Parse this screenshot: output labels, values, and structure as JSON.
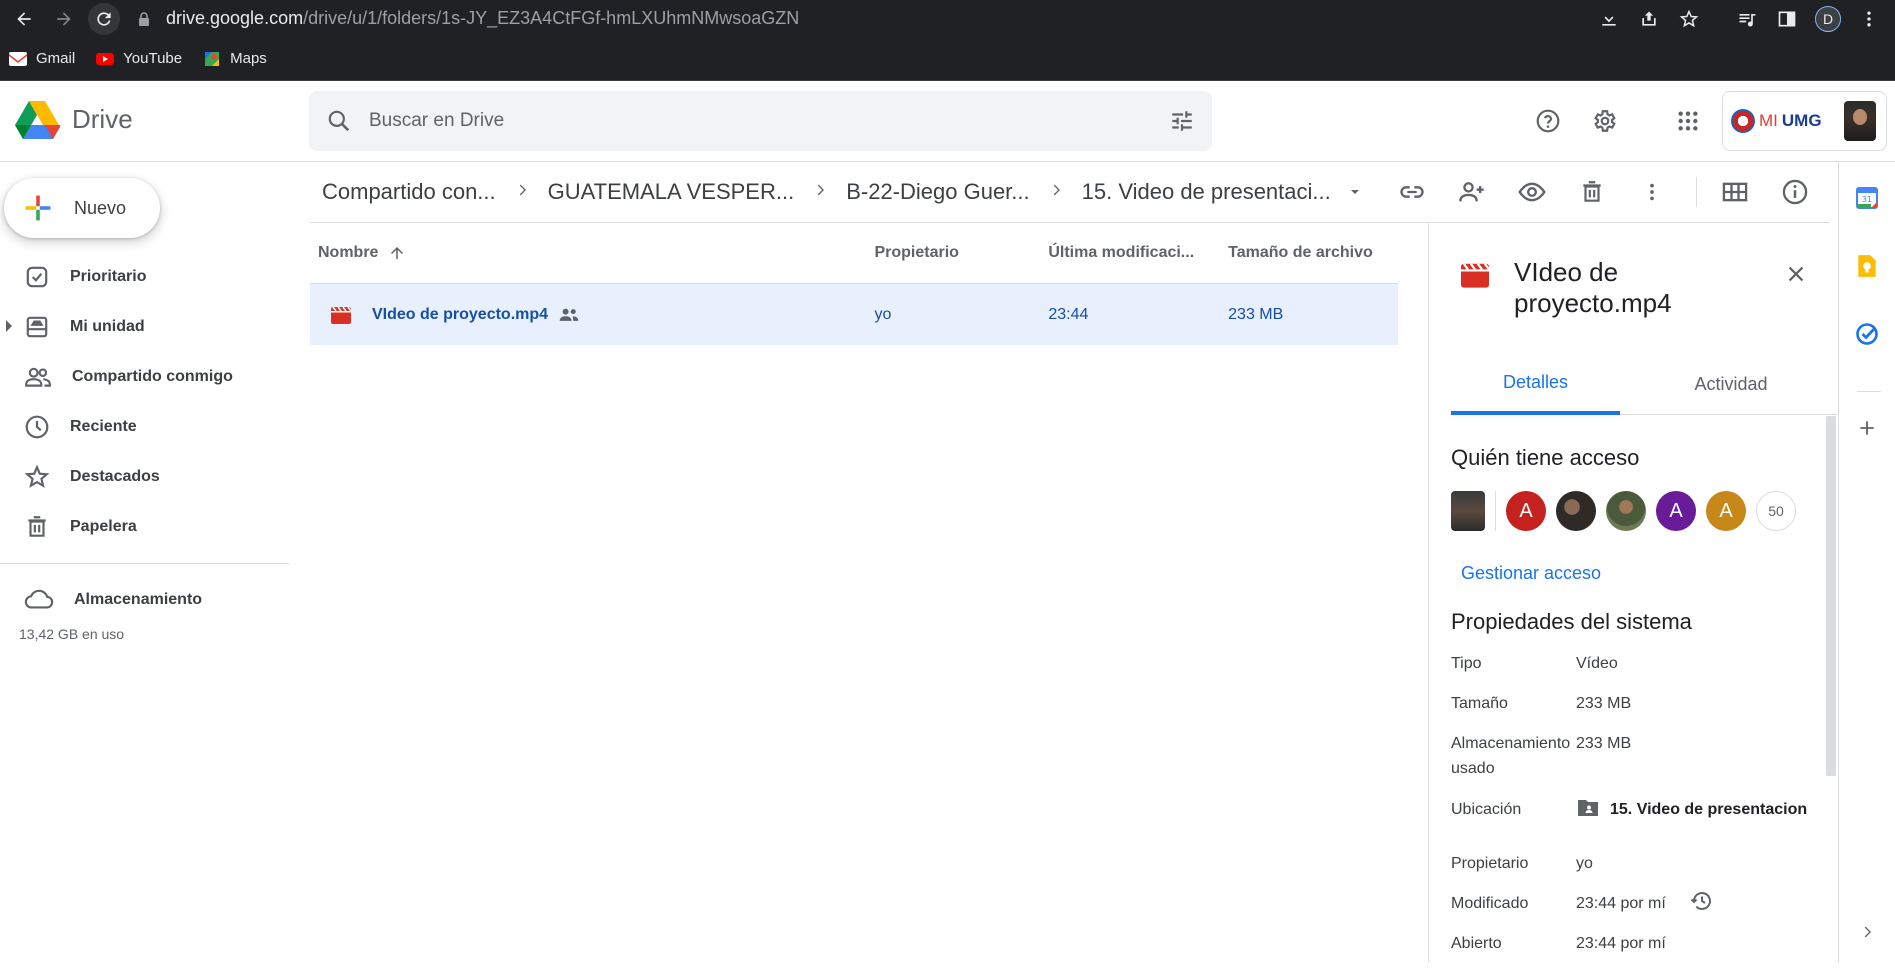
{
  "browser": {
    "url_host": "drive.google.com",
    "url_path": "/drive/u/1/folders/1s-JY_EZ3A4CtFGf-hmLXUhmNMwsoaGZN",
    "profile_initial": "D",
    "bookmarks": [
      {
        "label": "Gmail",
        "icon": "gmail-icon"
      },
      {
        "label": "YouTube",
        "icon": "youtube-icon"
      },
      {
        "label": "Maps",
        "icon": "maps-icon"
      }
    ]
  },
  "header": {
    "app_name": "Drive",
    "search_placeholder": "Buscar en Drive",
    "account_logo_prefix": "MI",
    "account_logo_text": "UMG"
  },
  "nav": {
    "new_label": "Nuevo",
    "items": [
      {
        "label": "Prioritario",
        "icon": "priority-check-icon"
      },
      {
        "label": "Mi unidad",
        "icon": "my-drive-icon"
      },
      {
        "label": "Compartido conmigo",
        "icon": "shared-people-icon"
      },
      {
        "label": "Reciente",
        "icon": "clock-icon"
      },
      {
        "label": "Destacados",
        "icon": "star-icon"
      },
      {
        "label": "Papelera",
        "icon": "trash-icon"
      }
    ],
    "storage_label": "Almacenamiento",
    "storage_used": "13,42 GB en uso"
  },
  "breadcrumb": [
    "Compartido con...",
    "GUATEMALA VESPER...",
    "B-22-Diego Guer...",
    "15. Video de presentaci..."
  ],
  "list": {
    "columns": {
      "name": "Nombre",
      "owner": "Propietario",
      "modified": "Última modificaci...",
      "size": "Tamaño de archivo"
    },
    "rows": [
      {
        "name": "VIdeo de proyecto.mp4",
        "owner": "yo",
        "modified": "23:44",
        "size": "233 MB"
      }
    ]
  },
  "details": {
    "title": "VIdeo de proyecto.mp4",
    "tab_details": "Detalles",
    "tab_activity": "Actividad",
    "access_title": "Quién tiene acceso",
    "access_avatars": [
      {
        "letter": "A",
        "color": "#c5221f"
      },
      {
        "letter": "",
        "color": ""
      },
      {
        "letter": "",
        "color": ""
      },
      {
        "letter": "A",
        "color": "#6a1b9a"
      },
      {
        "letter": "A",
        "color": "#c88719"
      }
    ],
    "access_count": "50",
    "manage_access": "Gestionar acceso",
    "system_props_title": "Propiedades del sistema",
    "props": {
      "type_k": "Tipo",
      "type_v": "Vídeo",
      "size_k": "Tamaño",
      "size_v": "233 MB",
      "storage_k": "Almacenamiento usado",
      "storage_v": "233 MB",
      "location_k": "Ubicación",
      "location_v": "15. Video de presentacion",
      "owner_k": "Propietario",
      "owner_v": "yo",
      "modified_k": "Modificado",
      "modified_v": "23:44 por mí",
      "opened_k": "Abierto",
      "opened_v": "23:44 por mí"
    }
  },
  "colors": {
    "accent": "#1a73e8",
    "selected_row": "#e8f0fe",
    "video_red": "#d93025"
  }
}
